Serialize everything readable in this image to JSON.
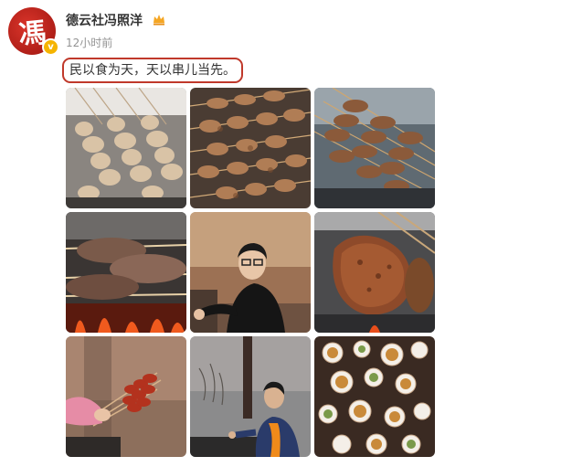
{
  "post": {
    "author": {
      "name": "德云社冯照洋",
      "avatar_glyph": "馮",
      "verified_icon": "verified-badge-icon",
      "member_icon": "crown-icon"
    },
    "time": "12小时前",
    "text": "民以食为天，天以串儿当先。",
    "photos": [
      {
        "label": "chicken-skewers"
      },
      {
        "label": "lamb-skewers"
      },
      {
        "label": "grilled-skewers-closeup"
      },
      {
        "label": "roasting-meat-over-fire"
      },
      {
        "label": "boy-in-black-jacket"
      },
      {
        "label": "grilled-steak"
      },
      {
        "label": "hand-holding-skewers"
      },
      {
        "label": "man-at-grill"
      },
      {
        "label": "table-of-dishes"
      }
    ]
  },
  "colors": {
    "highlight_border": "#c0392b",
    "verified": "#f5b400",
    "avatar_red": "#c4241c"
  }
}
